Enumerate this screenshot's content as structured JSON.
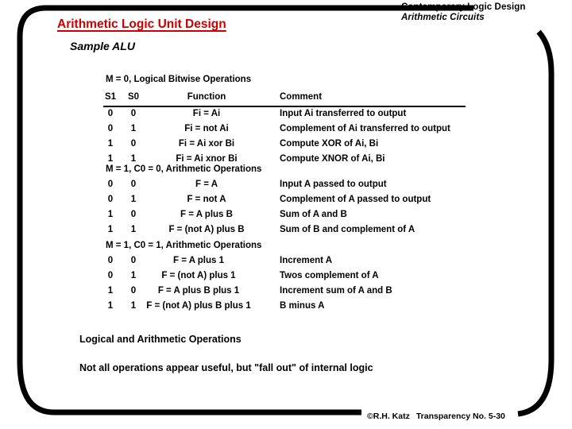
{
  "header": {
    "course": "Contemporary Logic Design",
    "chapter": "Arithmetic Circuits",
    "title": "Arithmetic Logic Unit Design",
    "subtitle": "Sample ALU"
  },
  "colors": {
    "title_red": "#cc0000",
    "text_black": "#000000",
    "frame_black": "#000000",
    "background": "#ffffff"
  },
  "tables": [
    {
      "caption": "M = 0, Logical Bitwise Operations",
      "columns": [
        "S1",
        "S0",
        "Function",
        "Comment"
      ],
      "has_header": true,
      "rows": [
        {
          "s1": "0",
          "s0": "0",
          "function": "Fi = Ai",
          "comment": "Input Ai transferred to output"
        },
        {
          "s1": "0",
          "s0": "1",
          "function": "Fi = not Ai",
          "comment": "Complement of Ai transferred to output"
        },
        {
          "s1": "1",
          "s0": "0",
          "function": "Fi = Ai xor Bi",
          "comment": "Compute XOR of Ai, Bi"
        },
        {
          "s1": "1",
          "s0": "1",
          "function": "Fi = Ai xnor Bi",
          "comment": "Compute XNOR of Ai, Bi"
        }
      ]
    },
    {
      "caption": "M = 1, C0 = 0, Arithmetic Operations",
      "columns": [
        "S1",
        "S0",
        "Function",
        "Comment"
      ],
      "has_header": false,
      "rows": [
        {
          "s1": "0",
          "s0": "0",
          "function": "F = A",
          "comment": "Input A passed to output"
        },
        {
          "s1": "0",
          "s0": "1",
          "function": "F = not A",
          "comment": "Complement of A passed to output"
        },
        {
          "s1": "1",
          "s0": "0",
          "function": "F = A plus B",
          "comment": "Sum of A and B"
        },
        {
          "s1": "1",
          "s0": "1",
          "function": "F = (not A) plus B",
          "comment": "Sum of B and complement of A"
        }
      ]
    },
    {
      "caption": "M = 1, C0 = 1, Arithmetic Operations",
      "columns": [
        "S1",
        "S0",
        "Function",
        "Comment"
      ],
      "has_header": false,
      "rows": [
        {
          "s1": "0",
          "s0": "0",
          "function": "F = A plus 1",
          "comment": "Increment A"
        },
        {
          "s1": "0",
          "s0": "1",
          "function": "F = (not A) plus 1",
          "comment": "Twos complement of A"
        },
        {
          "s1": "1",
          "s0": "0",
          "function": "F = A plus B plus 1",
          "comment": "Increment sum of A and B"
        },
        {
          "s1": "1",
          "s0": "1",
          "function": "F = (not A) plus B plus 1",
          "comment": "B minus A"
        }
      ]
    }
  ],
  "notes": {
    "line1": "Logical and Arithmetic Operations",
    "line2": "Not all operations appear useful, but \"fall out\" of internal logic"
  },
  "footer": {
    "copyright": "©R.H. Katz",
    "transparency": "Transparency No. 5-30"
  }
}
